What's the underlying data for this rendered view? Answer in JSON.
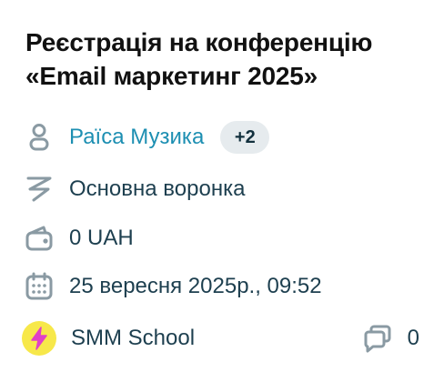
{
  "deal": {
    "title_line1": "Реєстрація на конференцію",
    "title_line2": "«Email маркетинг 2025»"
  },
  "contact": {
    "name": "Раїса Музика",
    "extra_count": "+2",
    "icon": "person-icon"
  },
  "funnel": {
    "name": "Основна воронка",
    "icon": "funnel-icon"
  },
  "amount": {
    "value": "0 UAH",
    "icon": "wallet-icon"
  },
  "date": {
    "value": "25 вересня 2025р., 09:52",
    "icon": "calendar-icon"
  },
  "source": {
    "name": "SMM School",
    "icon": "lightning-icon",
    "avatar_color": "#f7e84a",
    "icon_color": "#e040c8"
  },
  "comments": {
    "count": "0",
    "icon": "comments-icon"
  },
  "colors": {
    "link": "#1d8fb2",
    "text": "#1d3f4f",
    "icon": "#8a9aa3",
    "badge_bg": "#e6ebee"
  }
}
